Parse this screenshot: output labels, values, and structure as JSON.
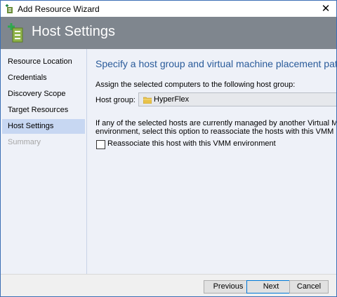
{
  "window": {
    "title": "Add Resource Wizard",
    "close_glyph": "✕"
  },
  "header": {
    "title": "Host Settings"
  },
  "sidebar": {
    "items": [
      {
        "label": "Resource Location"
      },
      {
        "label": "Credentials"
      },
      {
        "label": "Discovery Scope"
      },
      {
        "label": "Target Resources"
      },
      {
        "label": "Host Settings",
        "selected": true
      },
      {
        "label": "Summary",
        "disabled": true
      }
    ]
  },
  "main": {
    "heading": "Specify a host group and virtual machine placement path settin",
    "assign_text": "Assign the selected computers to the following host group:",
    "host_group_label": "Host group:",
    "host_group_value": "HyperFlex",
    "info_line1": "If any of the selected hosts are currently managed by another Virtual Machine Manag",
    "info_line2": "environment, select this option to reassociate the hosts with this VMM management",
    "reassociate_label": "Reassociate this host with this VMM environment",
    "reassociate_checked": false
  },
  "footer": {
    "previous": "Previous",
    "next": "Next",
    "cancel": "Cancel"
  },
  "colors": {
    "header_bg": "#7f868e",
    "accent": "#2a5b9a",
    "selection": "#c7d7f2"
  }
}
